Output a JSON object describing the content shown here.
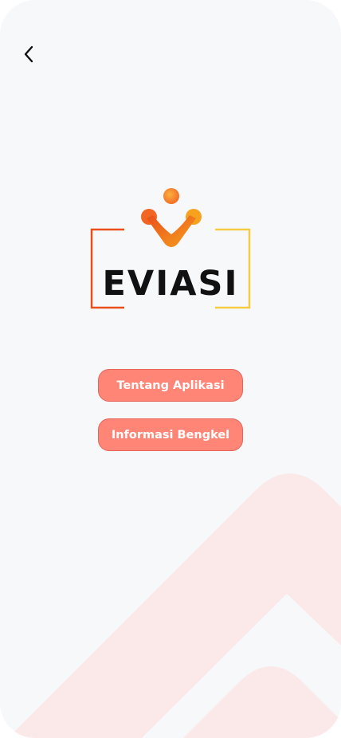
{
  "app": {
    "logo_text": "EVIASI"
  },
  "header": {
    "back_icon": "chevron-left-icon"
  },
  "menu": {
    "about_label": "Tentang Aplikasi",
    "workshop_label": "Informasi Bengkel"
  },
  "colors": {
    "screen_background": "#f7f8fa",
    "button_fill": "#ff8577",
    "button_border": "#e8645a",
    "button_text": "#ffffff",
    "decor_shape": "#fbe9ea",
    "logo_orange": "#f5861f",
    "logo_red": "#e94e1b",
    "logo_yellow": "#f6cc45"
  }
}
